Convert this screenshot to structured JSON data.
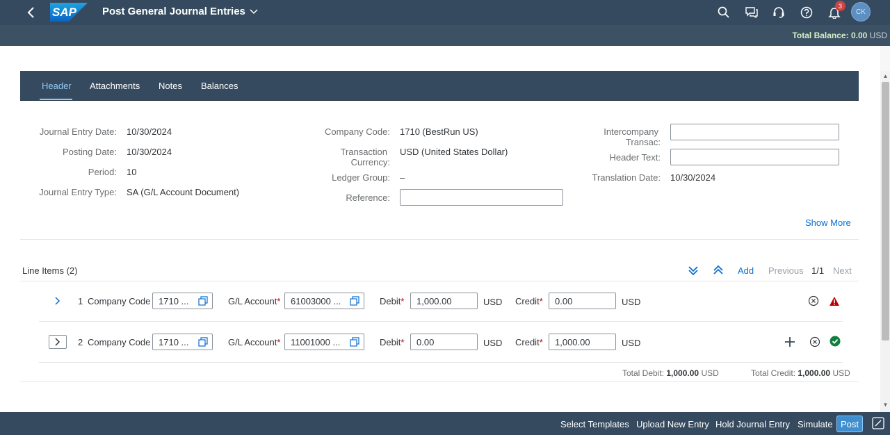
{
  "shell": {
    "logo_text": "SAP",
    "title": "Post General Journal Entries",
    "notification_count": "3",
    "avatar_initials": "CK"
  },
  "subheader": {
    "total_balance_label": "Total Balance:",
    "total_balance_value": "0.00",
    "total_balance_currency": "USD"
  },
  "tabs": [
    {
      "label": "Header",
      "active": true
    },
    {
      "label": "Attachments"
    },
    {
      "label": "Notes"
    },
    {
      "label": "Balances"
    }
  ],
  "header_form": {
    "journal_entry_date_label": "Journal Entry Date:",
    "journal_entry_date": "10/30/2024",
    "posting_date_label": "Posting Date:",
    "posting_date": "10/30/2024",
    "period_label": "Period:",
    "period": "10",
    "journal_entry_type_label": "Journal Entry Type:",
    "journal_entry_type": "SA (G/L Account Document)",
    "company_code_label": "Company Code:",
    "company_code": "1710 (BestRun US)",
    "transaction_currency_label_1": "Transaction",
    "transaction_currency_label_2": "Currency:",
    "transaction_currency": "USD (United States Dollar)",
    "ledger_group_label": "Ledger Group:",
    "ledger_group": "–",
    "reference_label": "Reference:",
    "reference_value": "",
    "intercompany_label_1": "Intercompany",
    "intercompany_label_2": "Transac:",
    "intercompany_value": "",
    "header_text_label": "Header Text:",
    "header_text_value": "",
    "translation_date_label": "Translation Date:",
    "translation_date": "10/30/2024",
    "show_more": "Show More"
  },
  "line_items": {
    "title": "Line Items (2)",
    "add": "Add",
    "previous": "Previous",
    "page": "1/1",
    "next": "Next",
    "company_code_label": "Company Code",
    "gl_account_label": "G/L Account",
    "debit_label": "Debit",
    "credit_label": "Credit",
    "required_mark": "*",
    "rows": [
      {
        "num": "1",
        "company_code": "1710 ...",
        "gl_account": "61003000 ...",
        "debit": "1,000.00",
        "debit_cur": "USD",
        "credit": "0.00",
        "credit_cur": "USD",
        "status": "error"
      },
      {
        "num": "2",
        "company_code": "1710 ...",
        "gl_account": "11001000 ...",
        "debit": "0.00",
        "debit_cur": "USD",
        "credit": "1,000.00",
        "credit_cur": "USD",
        "status": "success"
      }
    ],
    "total_debit_label": "Total Debit:",
    "total_debit": "1,000.00",
    "total_debit_cur": "USD",
    "total_credit_label": "Total Credit:",
    "total_credit": "1,000.00",
    "total_credit_cur": "USD"
  },
  "footer": {
    "select_templates": "Select Templates",
    "upload_new_entry": "Upload New Entry",
    "hold_journal_entry": "Hold Journal Entry",
    "simulate": "Simulate",
    "post": "Post"
  },
  "colors": {
    "shell": "#354a5f",
    "accent": "#0a6ed1",
    "error": "#bb0000",
    "success": "#107e3e"
  }
}
